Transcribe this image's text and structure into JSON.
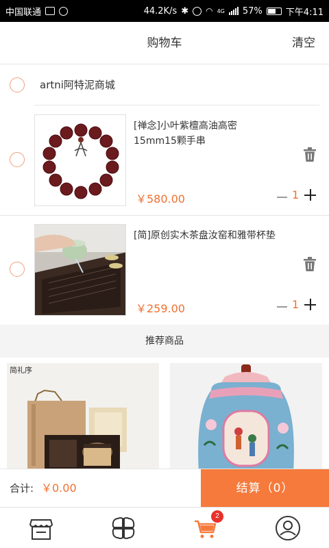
{
  "status_bar": {
    "carrier": "中国联通",
    "net_speed": "44.2K/s",
    "network_type": "4G",
    "battery": "57%",
    "time": "下午4:11"
  },
  "header": {
    "title": "购物车",
    "clear_label": "清空"
  },
  "shop": {
    "name": "artni阿特泥商城"
  },
  "cart_items": [
    {
      "title": "[禅念]小叶紫檀高油高密15mm15颗手串",
      "price": "￥580.00",
      "quantity": "1"
    },
    {
      "title": "[简]原创实木茶盘汝窑和雅带杯垫",
      "price": "￥259.00",
      "quantity": "1"
    }
  ],
  "recommend": {
    "title": "推荐商品",
    "products": [
      {
        "image": "tea-gift-box",
        "brand_text": "简礼序"
      },
      {
        "image": "famille-rose-jar"
      }
    ]
  },
  "checkout": {
    "total_label": "合计:",
    "total_value": "￥0.00",
    "button_label": "结算（0）"
  },
  "bottom_nav": {
    "items": [
      {
        "icon": "store-icon"
      },
      {
        "icon": "category-icon"
      },
      {
        "icon": "cart-icon",
        "active": true,
        "badge": "2"
      },
      {
        "icon": "profile-icon"
      }
    ]
  },
  "colors": {
    "accent": "#f57a3c",
    "price": "#f07030",
    "badge": "#e8312b",
    "radio_border": "#f0a07a"
  }
}
